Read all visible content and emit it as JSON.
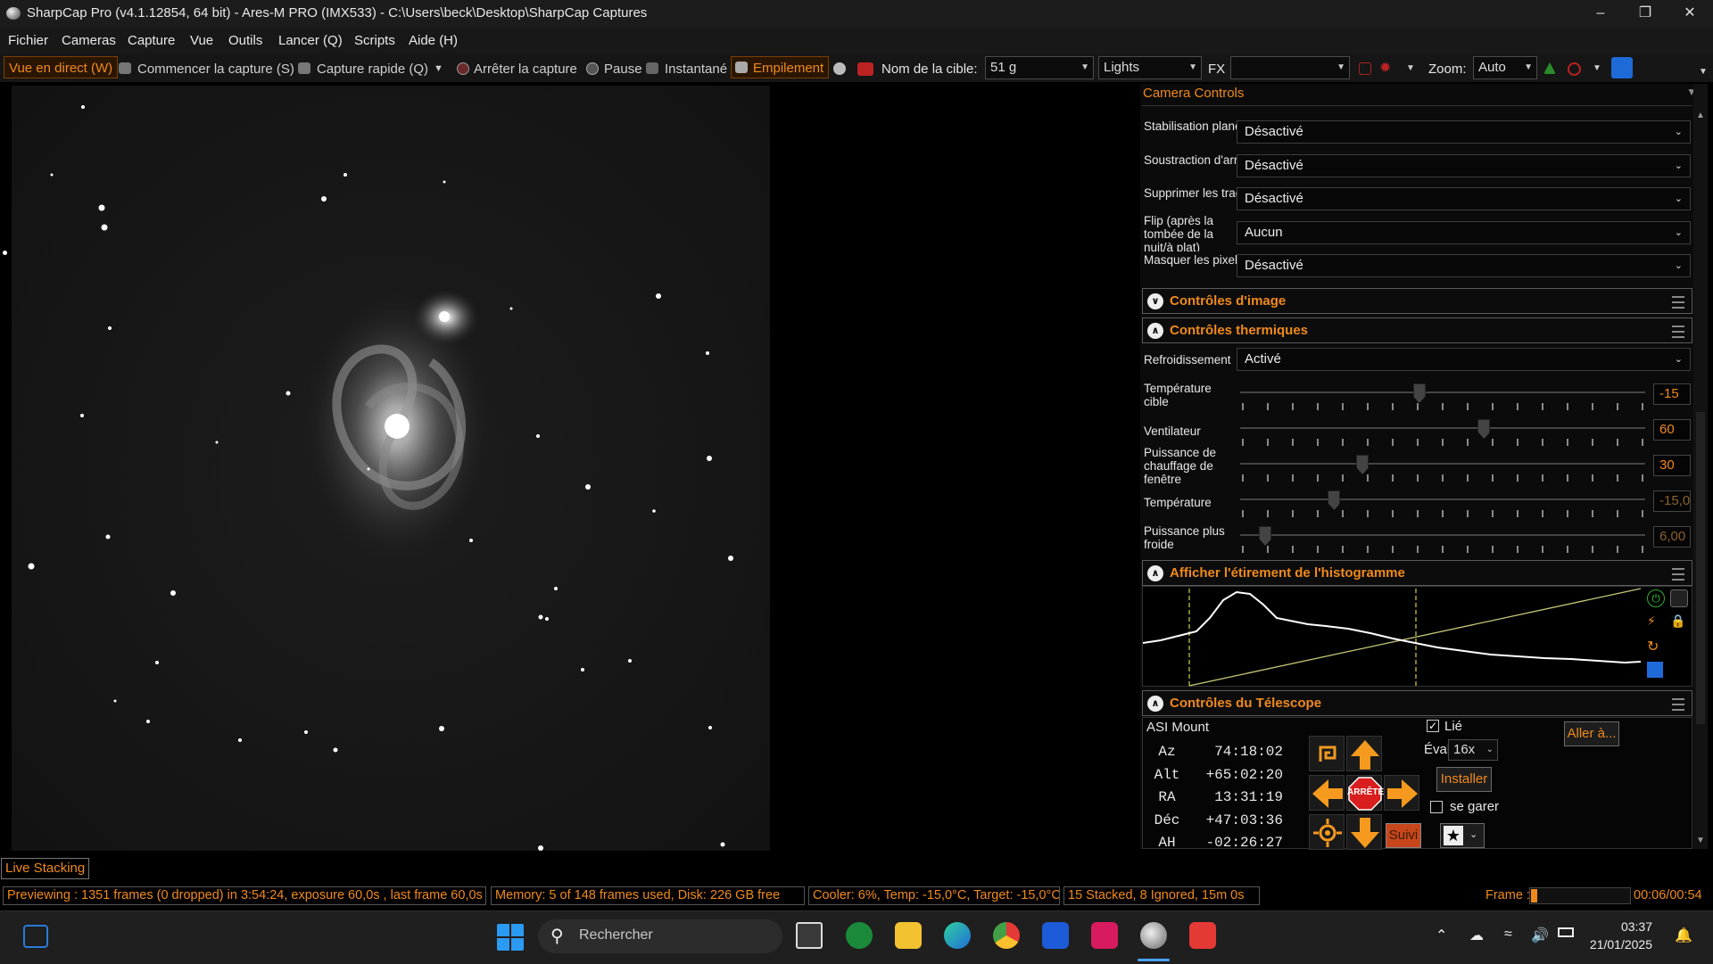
{
  "window": {
    "title": "SharpCap Pro (v4.1.12854, 64 bit) - Ares-M PRO (IMX533) - C:\\Users\\beck\\Desktop\\SharpCap Captures"
  },
  "menu": [
    "Fichier",
    "Cameras",
    "Capture",
    "Vue",
    "Outils",
    "Lancer (Q)",
    "Scripts",
    "Aide (H)"
  ],
  "toolbar": {
    "live_view": "Vue en direct (W)",
    "start_capture": "Commencer la capture (S)",
    "quick_capture": "Capture rapide (Q)",
    "stop_capture": "Arrêter la capture",
    "pause": "Pause",
    "snapshot": "Instantané",
    "stacking": "Empilement",
    "target_label": "Nom de la cible:",
    "target_value": "51 g",
    "frame_type": "Lights",
    "fx_label": "FX",
    "fx_value": "",
    "zoom_label": "Zoom:",
    "zoom_value": "Auto"
  },
  "panel": {
    "title": "Camera Controls",
    "rows": [
      {
        "label": "Stabilisation planète / disque",
        "value": "Désactivé"
      },
      {
        "label": "Soustraction d'arrière-plan",
        "value": "Désactivé"
      },
      {
        "label": "Supprimer les traces satellites",
        "value": "Désactivé"
      },
      {
        "label": "Flip (après la tombée de la nuit/à plat)",
        "value": "Aucun"
      },
      {
        "label": "Masquer les pixels exposés",
        "value": "Désactivé"
      }
    ],
    "image_controls": "Contrôles d'image",
    "thermal": {
      "title": "Contrôles thermiques",
      "cooling_label": "Refroidissement",
      "cooling_value": "Activé",
      "sliders": [
        {
          "label": "Température cible",
          "value": "-15",
          "level": 0.44
        },
        {
          "label": "Ventilateur",
          "value": "60",
          "level": 0.6
        },
        {
          "label": "Puissance de chauffage de fenêtre",
          "value": "30",
          "level": 0.3
        },
        {
          "label": "Température",
          "value": "-15,0",
          "level": 0.23
        },
        {
          "label": "Puissance plus froide",
          "value": "6,00",
          "level": 0.06
        }
      ]
    },
    "histogram_title": "Afficher l'étirement de l'histogramme",
    "telescope": {
      "title": "Contrôles du Télescope",
      "mount": "ASI Mount",
      "linked_label": "Lié",
      "linked": true,
      "goto": "Aller à...",
      "rate_label": "Évaluer:",
      "rate_value": "16x",
      "install": "Installer",
      "park_label": "se garer",
      "stop": "ARRÊTE",
      "track": "Suivi",
      "coords": [
        {
          "name": "Az",
          "value": "74:18:02"
        },
        {
          "name": "Alt",
          "value": "+65:02:20"
        },
        {
          "name": "RA",
          "value": "13:31:19"
        },
        {
          "name": "Déc",
          "value": "+47:03:36"
        },
        {
          "name": "AH",
          "value": "-02:26:27"
        }
      ]
    }
  },
  "live_stacking_tab": "Live Stacking",
  "status": {
    "preview": "Previewing : 1351 frames (0 dropped) in 3:54:24, exposure 60,0s , last frame 60,0s",
    "memory": "Memory: 5 of 148 frames used, Disk: 226 GB free",
    "cooler": "Cooler: 6%, Temp: -15,0°C, Target: -15,0°C",
    "stacked": "15 Stacked, 8 Ignored, 15m 0s",
    "frame_label": "Frame :",
    "frame_time": "00:06/00:54",
    "frame_progress": 0.06
  },
  "taskbar": {
    "search_placeholder": "Rechercher",
    "time": "03:37",
    "date": "21/01/2025"
  },
  "colors": {
    "accent": "#f08a1c",
    "panel_bg": "#0b0b0b"
  }
}
